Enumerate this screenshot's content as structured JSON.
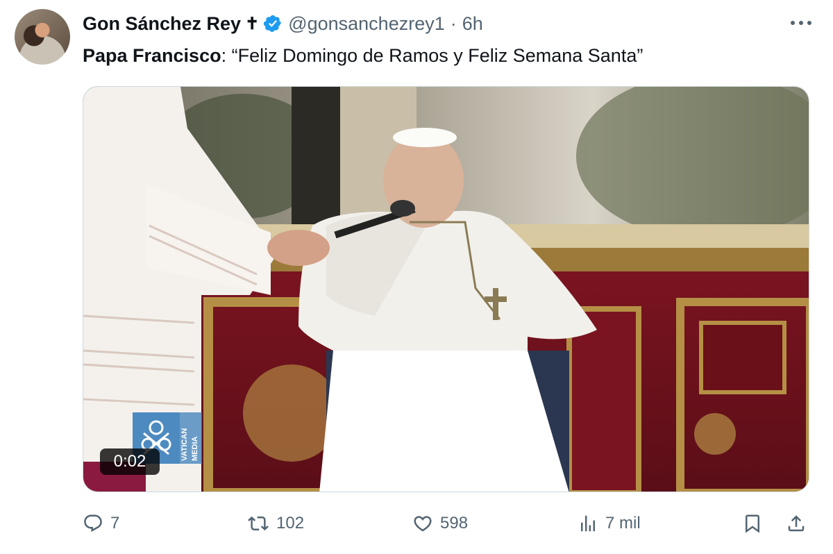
{
  "tweet": {
    "author_name": "Gon Sánchez Rey",
    "author_symbol": "✝",
    "handle": "@gonsanchezrey1",
    "separator": "·",
    "time": "6h",
    "text_bold": "Papa Francisco",
    "text_rest": ": “Feliz Domingo de Ramos y Feliz Semana Santa”",
    "verified_color": "#1d9bf0"
  },
  "media": {
    "duration": "0:02",
    "watermark_lines": [
      "VATICAN",
      "MEDIA"
    ]
  },
  "actions": {
    "replies": "7",
    "reposts": "102",
    "likes": "598",
    "views": "7 mil"
  },
  "icons": [
    "more-icon",
    "verified-icon",
    "reply-icon",
    "repost-icon",
    "like-icon",
    "views-icon",
    "bookmark-icon",
    "share-icon"
  ]
}
